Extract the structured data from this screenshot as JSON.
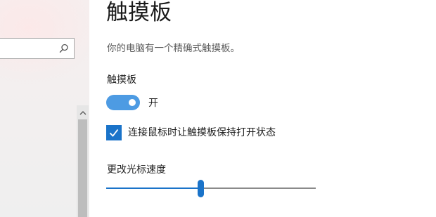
{
  "nav": {
    "search": {
      "value": "",
      "placeholder": "",
      "icon": "search-icon"
    },
    "scroll_up_icon": "chevron-up-icon"
  },
  "page": {
    "title": "触摸板",
    "description": "你的电脑有一个精确式触摸板。",
    "touchpad_section": {
      "label": "触摸板",
      "toggle_on": true,
      "toggle_state_text": "开"
    },
    "mouse_connected_option": {
      "checked": true,
      "label": "连接鼠标时让触摸板保持打开状态"
    },
    "cursor_speed": {
      "label": "更改光标速度",
      "value_fraction": 0.45
    }
  },
  "colors": {
    "accent": "#1a73c9",
    "toggle_on": "#4d9be3"
  }
}
